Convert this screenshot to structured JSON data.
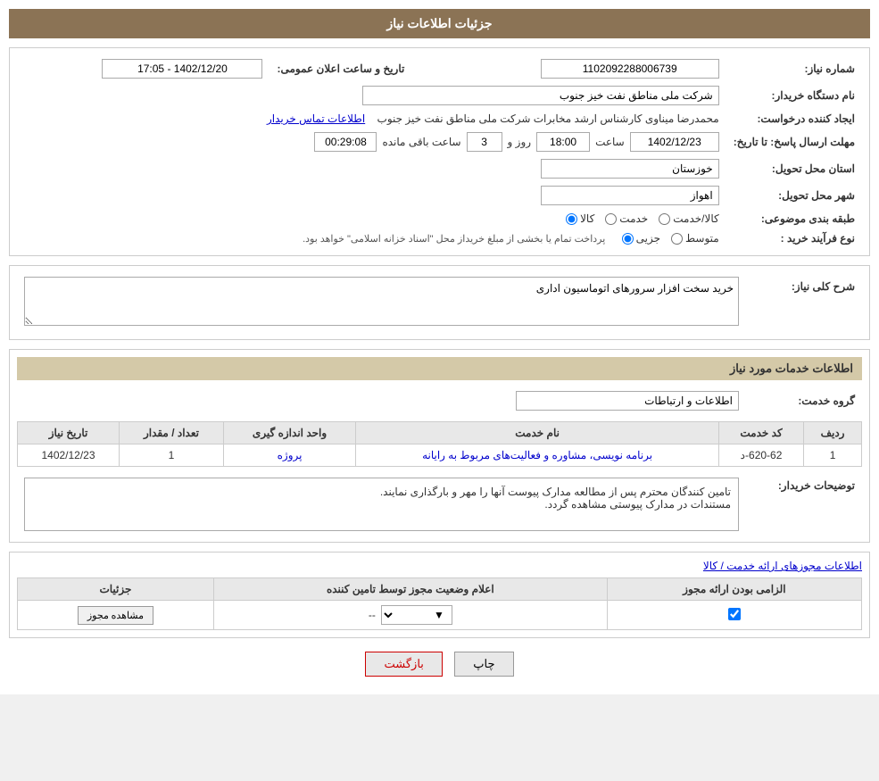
{
  "page": {
    "title": "جزئیات اطلاعات نیاز",
    "sections": {
      "main_info": {
        "fields": {
          "need_number_label": "شماره نیاز:",
          "need_number_value": "1102092288006739",
          "buyer_org_label": "نام دستگاه خریدار:",
          "buyer_org_value": "شرکت ملی مناطق نفت خیز جنوب",
          "announcement_label": "تاریخ و ساعت اعلان عمومی:",
          "announcement_value": "1402/12/20 - 17:05",
          "creator_label": "ایجاد کننده درخواست:",
          "creator_value": "محمدرضا میناوی کارشناس ارشد مخابرات شرکت ملی مناطق نفت خیز جنوب",
          "contact_link": "اطلاعات تماس خریدار",
          "reply_deadline_label": "مهلت ارسال پاسخ: تا تاریخ:",
          "reply_date": "1402/12/23",
          "reply_time_label": "ساعت",
          "reply_time": "18:00",
          "reply_days_label": "روز و",
          "reply_days": "3",
          "reply_remaining_label": "ساعت باقی مانده",
          "reply_remaining": "00:29:08",
          "province_label": "استان محل تحویل:",
          "province_value": "خوزستان",
          "city_label": "شهر محل تحویل:",
          "city_value": "اهواز",
          "category_label": "طبقه بندی موضوعی:",
          "category_options": [
            "کالا",
            "خدمت",
            "کالا/خدمت"
          ],
          "category_selected": "کالا",
          "process_label": "نوع فرآیند خرید :",
          "process_options": [
            "جزیی",
            "متوسط"
          ],
          "process_note": "پرداخت تمام یا بخشی از مبلغ خریداز محل \"اسناد خزانه اسلامی\" خواهد بود."
        }
      },
      "need_description": {
        "title": "شرح کلی نیاز:",
        "value": "خرید سخت افزار سرورهای اتوماسیون اداری"
      },
      "services_info": {
        "title": "اطلاعات خدمات مورد نیاز",
        "service_group_label": "گروه خدمت:",
        "service_group_value": "اطلاعات و ارتباطات",
        "table": {
          "headers": [
            "ردیف",
            "کد خدمت",
            "نام خدمت",
            "واحد اندازه گیری",
            "تعداد / مقدار",
            "تاریخ نیاز"
          ],
          "rows": [
            {
              "row": "1",
              "code": "620-62-د",
              "name": "برنامه نویسی، مشاوره و فعالیت‌های مربوط به رایانه",
              "unit": "پروژه",
              "quantity": "1",
              "date": "1402/12/23"
            }
          ]
        },
        "buyer_notes_label": "توضیحات خریدار:",
        "buyer_notes": "تامین کنندگان محترم پس از مطالعه مدارک پیوست آنها را مهر  و بارگذاری نمایند.\nمستندات در مدارک پیوستی مشاهده گردد."
      },
      "license_info": {
        "title": "اطلاعات مجوزهای ارائه خدمت / کالا",
        "table": {
          "headers": [
            "الزامی بودن ارائه مجوز",
            "اعلام وضعیت مجوز توسط تامین کننده",
            "جزئیات"
          ],
          "rows": [
            {
              "required": true,
              "status": "--",
              "details_btn": "مشاهده مجوز"
            }
          ]
        }
      }
    },
    "buttons": {
      "print": "چاپ",
      "back": "بازگشت"
    }
  }
}
